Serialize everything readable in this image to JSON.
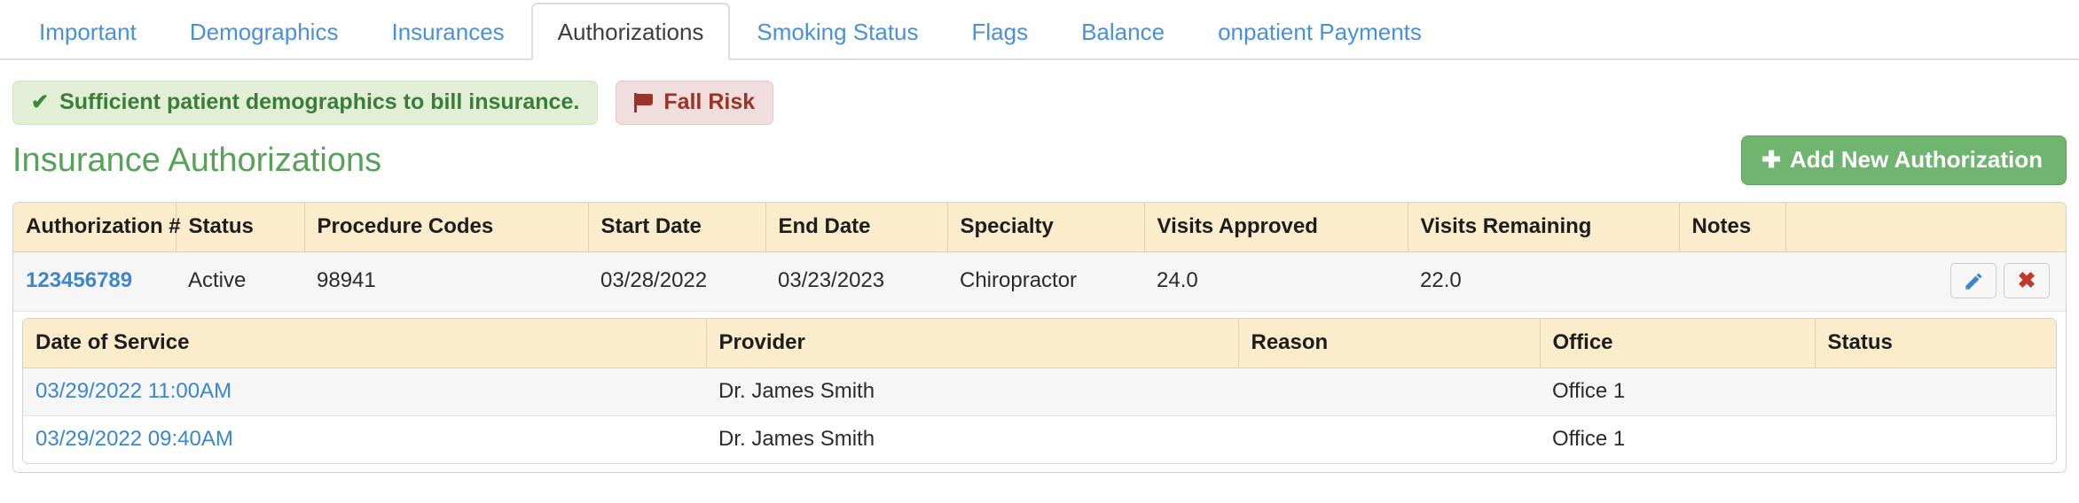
{
  "tabs": [
    {
      "label": "Important",
      "active": false
    },
    {
      "label": "Demographics",
      "active": false
    },
    {
      "label": "Insurances",
      "active": false
    },
    {
      "label": "Authorizations",
      "active": true
    },
    {
      "label": "Smoking Status",
      "active": false
    },
    {
      "label": "Flags",
      "active": false
    },
    {
      "label": "Balance",
      "active": false
    },
    {
      "label": "onpatient Payments",
      "active": false
    }
  ],
  "alerts": {
    "success": {
      "icon": "check-icon",
      "text": "Sufficient patient demographics to bill insurance."
    },
    "flag": {
      "icon": "flag-icon",
      "text": "Fall Risk"
    }
  },
  "header": {
    "title": "Insurance Authorizations",
    "add_button": {
      "icon": "plus-icon",
      "label": "Add New Authorization"
    }
  },
  "auth_table": {
    "columns": [
      "Authorization #",
      "Status",
      "Procedure Codes",
      "Start Date",
      "End Date",
      "Specialty",
      "Visits Approved",
      "Visits Remaining",
      "Notes",
      ""
    ],
    "rows": [
      {
        "authorization_number": "123456789",
        "status": "Active",
        "procedure_codes": "98941",
        "start_date": "03/28/2022",
        "end_date": "03/23/2023",
        "specialty": "Chiropractor",
        "visits_approved": "24.0",
        "visits_remaining": "22.0",
        "notes": "",
        "actions": {
          "edit_icon": "pencil-icon",
          "delete_icon": "x-icon",
          "delete_glyph": "✖"
        }
      }
    ]
  },
  "service_table": {
    "columns": [
      "Date of Service",
      "Provider",
      "Reason",
      "Office",
      "Status"
    ],
    "rows": [
      {
        "date_of_service": "03/29/2022 11:00AM",
        "provider": "Dr. James Smith",
        "reason": "",
        "office": "Office 1",
        "status": ""
      },
      {
        "date_of_service": "03/29/2022 09:40AM",
        "provider": "Dr. James Smith",
        "reason": "",
        "office": "Office 1",
        "status": ""
      }
    ]
  },
  "colors": {
    "tab_link": "#4a90d9",
    "tab_active_text": "#3d3d3d",
    "title_green": "#56a256",
    "button_green": "#6fb46f",
    "alert_success_bg": "#e3eed6",
    "alert_success_text": "#3a7d3a",
    "badge_danger_bg": "#f0dede",
    "badge_danger_text": "#9c3328",
    "table_header_bg": "#fbeccb",
    "link_blue": "#3a87cd",
    "delete_red": "#c0392b"
  }
}
